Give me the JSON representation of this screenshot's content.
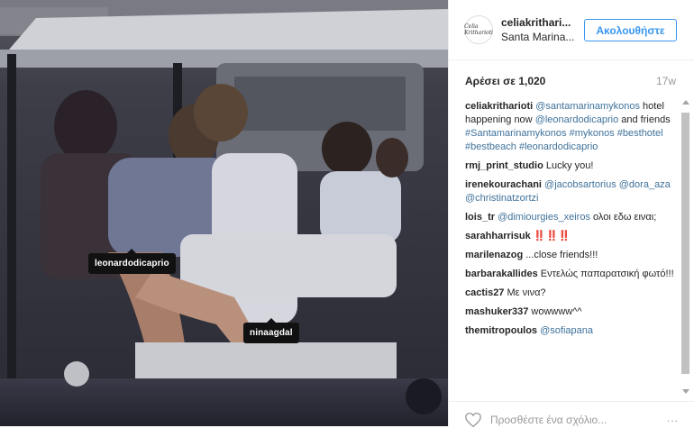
{
  "post": {
    "username": "celiakrithari...",
    "location": "Santa Marina...",
    "avatar_text": "Celia Kritharioti",
    "follow_label": "Ακολουθήστε",
    "likes_text": "Αρέσει σε 1,020",
    "age": "17w",
    "add_comment_placeholder": "Προσθέστε ένα σχόλιο...",
    "more": "...",
    "tags": [
      "leonardodicaprio",
      "ninaagdal"
    ]
  },
  "caption": {
    "user": "celiakritharioti",
    "mention1": "@santamarinamykonos",
    "text1": "hotel happening now",
    "mention2": "@leonardodicaprio",
    "text2": "and friends",
    "tag1": "#Santamarinamykonos",
    "tag2": "#mykonos",
    "tag3": "#besthotel",
    "tag4": "#bestbeach",
    "tag5": "#leonardodicaprio"
  },
  "comments": [
    {
      "user": "rmj_print_studio",
      "text": "Lucky you!"
    },
    {
      "user": "irenekourachani",
      "mention1": "@jacobsartorius",
      "mention2": "@dora_aza",
      "mention3": "@christinatzortzi"
    },
    {
      "user": "lois_tr",
      "mention": "@dimiourgies_xeiros",
      "text": "ολοι εδω ειναι;"
    },
    {
      "user": "sarahharrisuk",
      "text": "‼️‼️‼️"
    },
    {
      "user": "marilenazog",
      "text": "...close friends!!!"
    },
    {
      "user": "barbarakallides",
      "text": "Εντελώς παπαρατσική φωτό!!!"
    },
    {
      "user": "cactis27",
      "text": "Με νινα?"
    },
    {
      "user": "mashuker337",
      "text": "wowwww^^"
    },
    {
      "user": "themitropoulos",
      "mention": "@sofiapana"
    }
  ],
  "colors": {
    "link": "#3f729b",
    "follow": "#3897f0",
    "tag_bg": "#111111"
  }
}
